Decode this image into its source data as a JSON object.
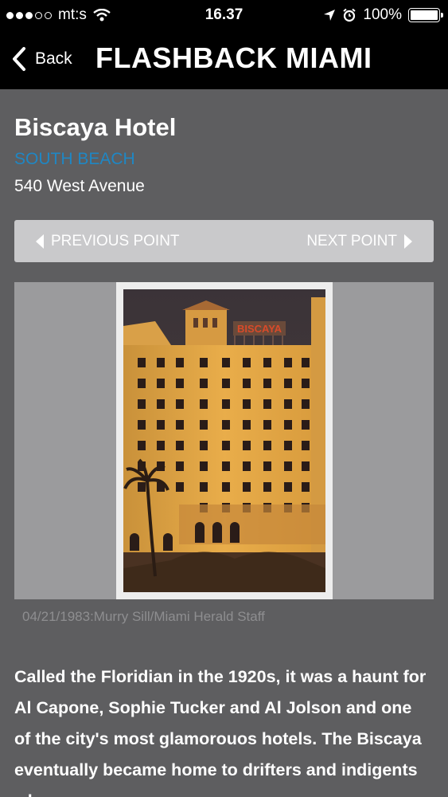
{
  "status_bar": {
    "carrier": "mt:s",
    "time": "16.37",
    "battery": "100%"
  },
  "nav": {
    "back_label": "Back",
    "title": "FLASHBACK MIAMI"
  },
  "place": {
    "name": "Biscaya Hotel",
    "area": "SOUTH BEACH",
    "address": "540 West Avenue"
  },
  "pager": {
    "previous_label": "PREVIOUS POINT",
    "next_label": "NEXT POINT"
  },
  "photo": {
    "caption": "04/21/1983:Murry Sill/Miami Herald Staff",
    "sign_text": "BISCAYA"
  },
  "description": "Called the Floridian in the 1920s, it was a haunt for Al Capone, Sophie Tucker and Al Jolson and one of the city's most glamorouos hotels. The Biscaya eventually became home to drifters and indigents who",
  "colors": {
    "background": "#5e5e60",
    "header": "#000000",
    "link": "#1f87c4",
    "pager": "#c9c9cb"
  }
}
